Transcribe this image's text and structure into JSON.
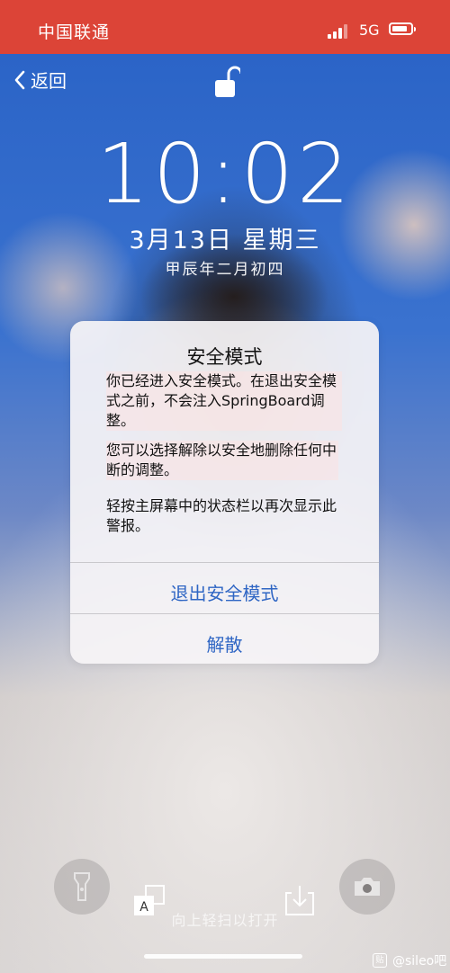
{
  "status_bar": {
    "carrier": "中国联通",
    "network": "5G",
    "background_color": "#dc4437"
  },
  "nav": {
    "back_label": "返回",
    "back_icon": "chevron-left-icon"
  },
  "lock_screen": {
    "lock_icon": "unlock-icon",
    "time": "10:02",
    "date": "3月13日 星期三",
    "lunar_date": "甲辰年二月初四",
    "swipe_hint": "向上轻扫以打开"
  },
  "alert": {
    "title": "安全模式",
    "message_1": "你已经进入安全模式。在退出安全模式之前，不会注入SpringBoard调整。",
    "message_2": "您可以选择解除以安全地删除任何中断的调整。",
    "message_3": "轻按主屏幕中的状态栏以再次显示此警报。",
    "button_exit": "退出安全模式",
    "button_dismiss": "解散",
    "button_color": "#2f66c4"
  },
  "bottom_controls": {
    "flashlight_icon": "flashlight-icon",
    "camera_icon": "camera-icon",
    "translate_icon": "translate-icon",
    "download_icon": "download-icon"
  },
  "watermark": {
    "text": "@sileo吧"
  }
}
